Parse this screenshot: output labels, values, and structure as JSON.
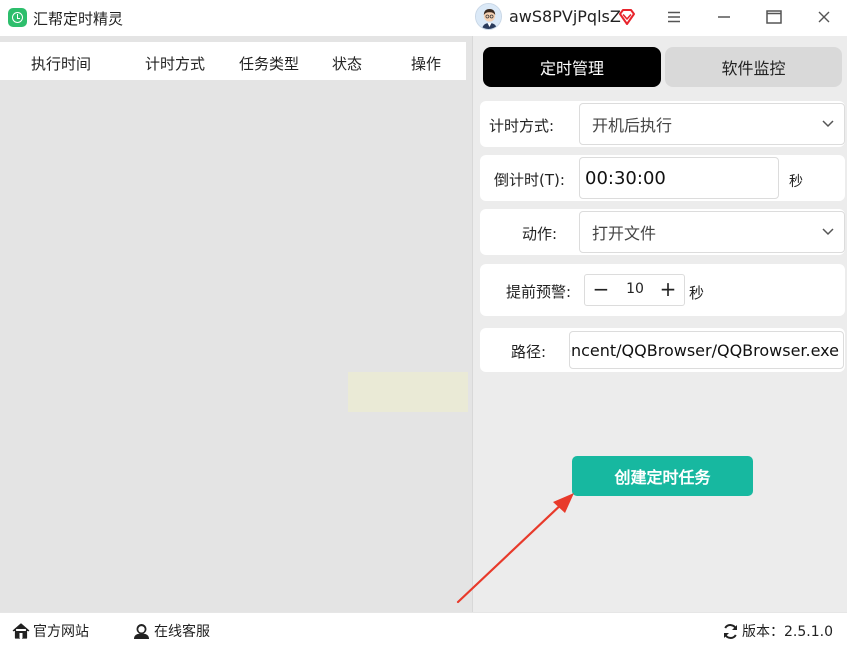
{
  "app": {
    "title": "汇帮定时精灵",
    "username": "awS8PVjPqlsZ",
    "accent": "#17b8a0"
  },
  "window_controls": [
    "menu-icon",
    "minimize-icon",
    "maximize-icon",
    "close-icon"
  ],
  "task_table": {
    "columns": [
      "执行时间",
      "计时方式",
      "任务类型",
      "状态",
      "操作"
    ],
    "rows": []
  },
  "tabs": [
    {
      "label": "定时管理",
      "active": true
    },
    {
      "label": "软件监控",
      "active": false
    }
  ],
  "form": {
    "timing_mode": {
      "label": "计时方式:",
      "value": "开机后执行"
    },
    "countdown": {
      "label": "倒计时(T):",
      "value": "00:30:00",
      "unit": "秒"
    },
    "action": {
      "label": "动作:",
      "value": "打开文件"
    },
    "advance_warning": {
      "label": "提前预警:",
      "value": "10",
      "unit": "秒",
      "minus": "−",
      "plus": "+"
    },
    "path": {
      "label": "路径:",
      "value": "encent/QQBrowser/QQBrowser.exe"
    }
  },
  "create_button": {
    "label": "创建定时任务"
  },
  "footer": {
    "website": "官方网站",
    "support": "在线客服",
    "version": "版本：2.5.1.0"
  }
}
